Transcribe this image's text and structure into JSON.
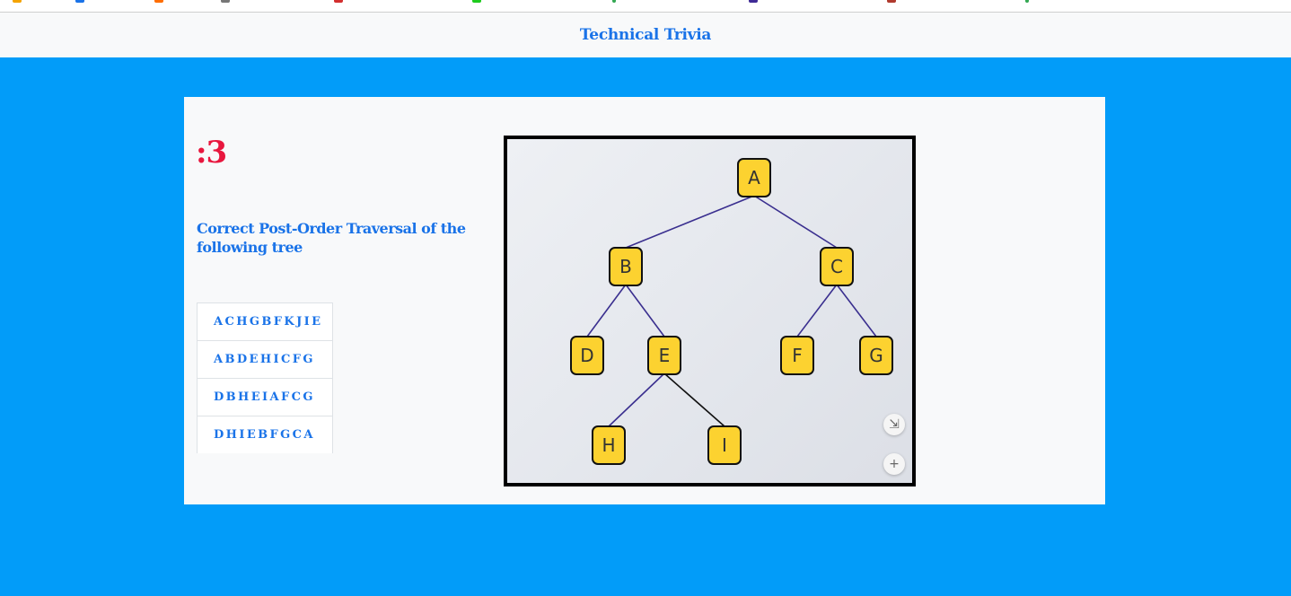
{
  "navbar": {
    "brand": "Technical Trivia"
  },
  "quiz": {
    "timer": ":3",
    "question": "Correct Post-Order Traversal of the following tree",
    "options": [
      "ACHGBFKJIE",
      "ABDEHICFG",
      "DBHEIAFCG",
      "DHIEBFGCA"
    ]
  },
  "tree": {
    "nodes": [
      {
        "label": "A",
        "id": "a"
      },
      {
        "label": "B",
        "id": "b"
      },
      {
        "label": "C",
        "id": "c"
      },
      {
        "label": "D",
        "id": "d"
      },
      {
        "label": "E",
        "id": "e"
      },
      {
        "label": "F",
        "id": "f"
      },
      {
        "label": "G",
        "id": "g"
      },
      {
        "label": "H",
        "id": "h"
      },
      {
        "label": "I",
        "id": "i"
      }
    ],
    "edges": [
      [
        "A",
        "B"
      ],
      [
        "A",
        "C"
      ],
      [
        "B",
        "D"
      ],
      [
        "B",
        "E"
      ],
      [
        "C",
        "F"
      ],
      [
        "C",
        "G"
      ],
      [
        "E",
        "H"
      ],
      [
        "E",
        "I"
      ]
    ],
    "node_color": "#fcd230",
    "edge_color": "#3a2f8f"
  },
  "zoom_controls": {
    "fit_icon": "fit-screen-icon",
    "plus_icon": "plus-icon",
    "plus_glyph": "+",
    "fit_glyph": "⇲"
  },
  "colors": {
    "background": "#029cf9",
    "accent": "#1a73e8",
    "timer": "#e8173e"
  }
}
